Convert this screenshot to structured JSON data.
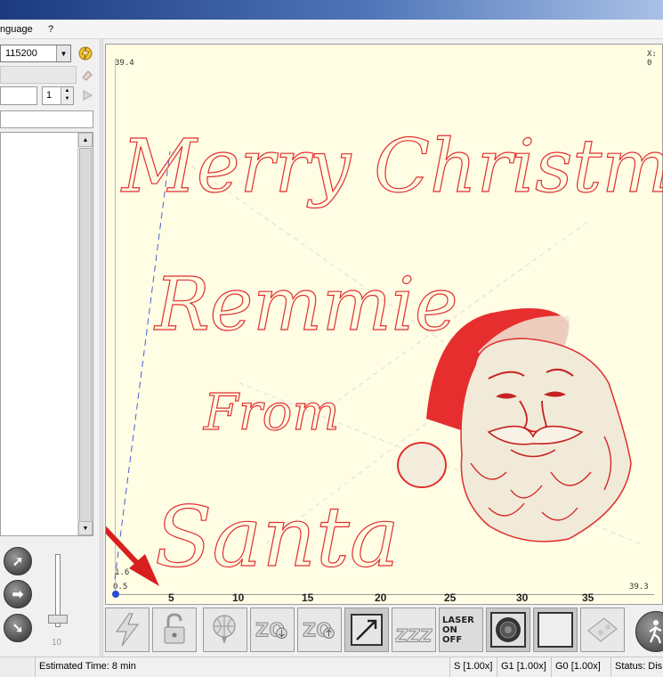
{
  "menu": {
    "language": "nguage",
    "help": "?"
  },
  "connection": {
    "baud_value": "115200"
  },
  "spin": {
    "value": "1"
  },
  "slider": {
    "label": "10"
  },
  "canvas": {
    "y_max_label": "39.4",
    "x_readout": "X: 0",
    "y_min_label": "1.6",
    "x_min_label": "0.5",
    "x_max_label": "39.3",
    "ticks": [
      "5",
      "10",
      "15",
      "20",
      "25",
      "30",
      "35"
    ],
    "engraving_text": [
      "Merry Christmas",
      "Remmie",
      "From",
      "Santa"
    ],
    "engraving_color": "#e03030"
  },
  "toolbar": {
    "laser_button_text": [
      "LASER",
      "ON",
      "OFF"
    ],
    "sleep_text": "ZZZ"
  },
  "status": {
    "estimated_time": "Estimated Time:  8 min",
    "s_override": "S [1.00x]",
    "g1_override": "G1 [1.00x]",
    "g0_override": "G0 [1.00x]",
    "status": "Status:  Dis"
  }
}
